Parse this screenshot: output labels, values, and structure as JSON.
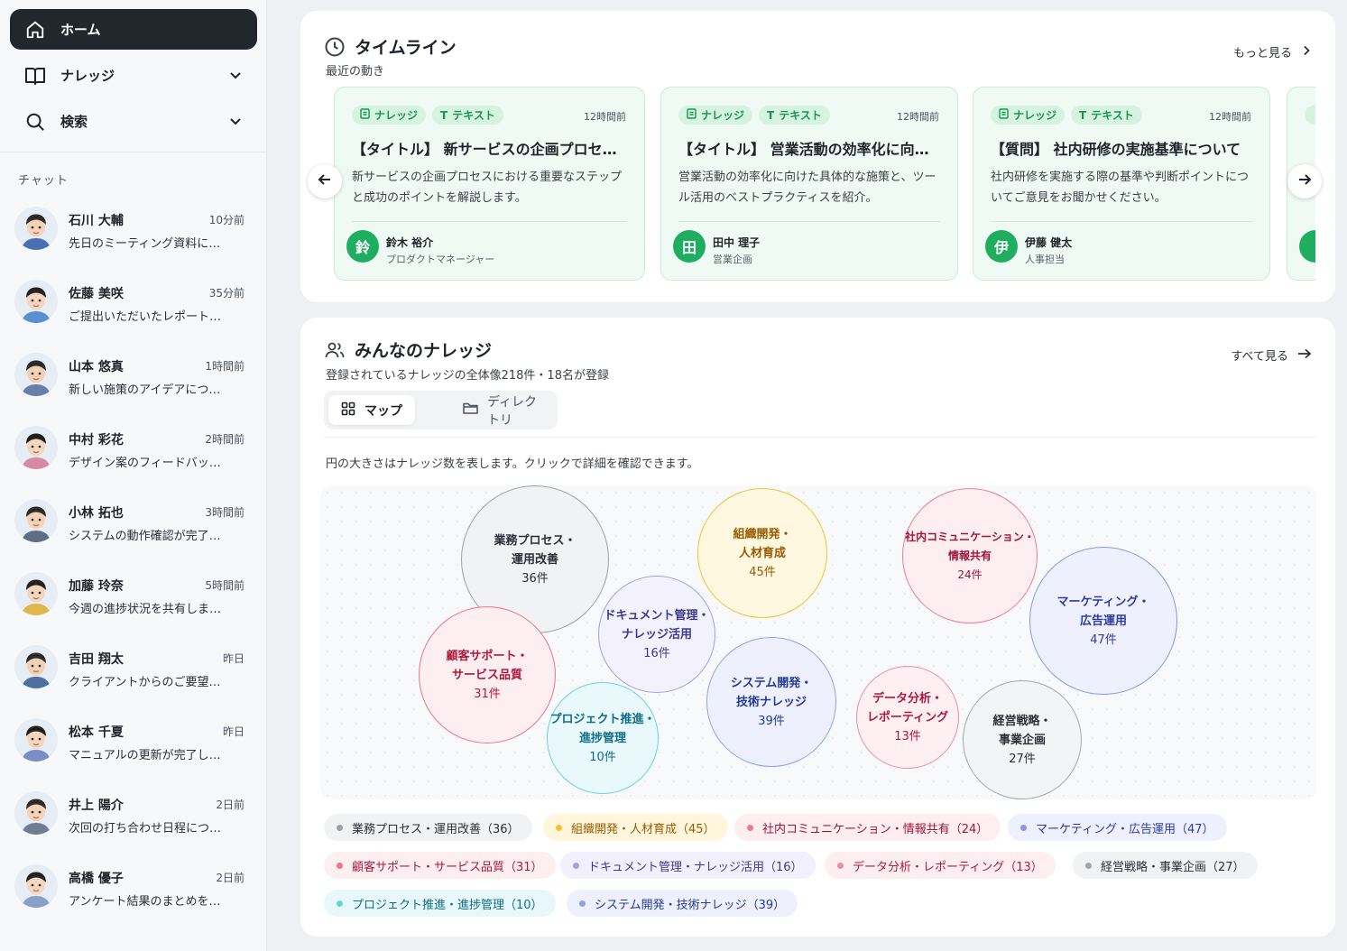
{
  "sidebar": {
    "nav": [
      {
        "label": "ホーム",
        "icon": "home-icon"
      },
      {
        "label": "ナレッジ",
        "icon": "book-icon"
      },
      {
        "label": "検索",
        "icon": "search-icon"
      }
    ],
    "chat_heading": "チャット",
    "chats": [
      {
        "name": "石川 大輔",
        "time": "10分前",
        "message": "先日のミーティング資料に…"
      },
      {
        "name": "佐藤 美咲",
        "time": "35分前",
        "message": "ご提出いただいたレポート…"
      },
      {
        "name": "山本 悠真",
        "time": "1時間前",
        "message": "新しい施策のアイデアにつ…"
      },
      {
        "name": "中村 彩花",
        "time": "2時間前",
        "message": "デザイン案のフィードバッ…"
      },
      {
        "name": "小林 拓也",
        "time": "3時間前",
        "message": "システムの動作確認が完了…"
      },
      {
        "name": "加藤 玲奈",
        "time": "5時間前",
        "message": "今週の進捗状況を共有しま…"
      },
      {
        "name": "吉田 翔太",
        "time": "昨日",
        "message": "クライアントからのご要望…"
      },
      {
        "name": "松本 千夏",
        "time": "昨日",
        "message": "マニュアルの更新が完了し…"
      },
      {
        "name": "井上 陽介",
        "time": "2日前",
        "message": "次回の打ち合わせ日程につ…"
      },
      {
        "name": "高橋 優子",
        "time": "2日前",
        "message": "アンケート結果のまとめを…"
      }
    ]
  },
  "timeline": {
    "title": "タイムライン",
    "subtitle": "最近の動き",
    "more_link": "もっと見る",
    "cards": [
      {
        "tag1": "ナレッジ",
        "tag2": "テキスト",
        "time": "12時間前",
        "title": "【タイトル】 新サービスの企画プロセスにおける重要なステップ",
        "body": "新サービスの企画プロセスにおける重要なステップと成功のポイントを解説します。",
        "author_initial": "鈴",
        "author": "鈴木 裕介",
        "role": "プロダクトマネージャー"
      },
      {
        "tag1": "ナレッジ",
        "tag2": "テキスト",
        "time": "12時間前",
        "title": "【タイトル】 営業活動の効率化に向けた具体的な施策",
        "body": "営業活動の効率化に向けた具体的な施策と、ツール活用のベストプラクティスを紹介。",
        "author_initial": "田",
        "author": "田中 理子",
        "role": "営業企画"
      },
      {
        "tag1": "ナレッジ",
        "tag2": "テキスト",
        "time": "12時間前",
        "title": "【質問】 社内研修の実施基準について",
        "body": "社内研修を実施する際の基準や判断ポイントについてご意見をお聞かせください。",
        "author_initial": "伊",
        "author": "伊藤 健太",
        "role": "人事担当"
      }
    ]
  },
  "knowledge": {
    "title": "みんなのナレッジ",
    "subtitle": "登録されているナレッジの全体像218件・18名が登録",
    "all_link": "すべて見る",
    "tab_map": "マップ",
    "tab_directory": "ディレクトリ",
    "note": "円の大きさはナレッジ数を表します。クリックで詳細を確認できます。",
    "categories": [
      {
        "line1": "業務プロセス・",
        "line2": "運用改善",
        "count": "36件",
        "legend": "業務プロセス・運用改善（36）",
        "color": "#9aa0aa",
        "text": "#2b2f36"
      },
      {
        "line1": "組織開発・",
        "line2": "人材育成",
        "count": "45件",
        "legend": "組織開発・人材育成（45）",
        "color": "#f2c230",
        "text": "#9a5a00"
      },
      {
        "line1": "社内コミュニケーション・",
        "line2": "情報共有",
        "count": "24件",
        "legend": "社内コミュニケーション・情報共有（24）",
        "color": "#f07a94",
        "text": "#a3143a"
      },
      {
        "line1": "マーケティング・",
        "line2": "広告運用",
        "count": "47件",
        "legend": "マーケティング・広告運用（47）",
        "color": "#8a95ea",
        "text": "#2f3c9e"
      },
      {
        "line1": "顧客サポート・",
        "line2": "サービス品質",
        "count": "31件",
        "legend": "顧客サポート・サービス品質（31）",
        "color": "#f0728b",
        "text": "#b0183d"
      },
      {
        "line1": "ドキュメント管理・",
        "line2": "ナレッジ活用",
        "count": "16件",
        "legend": "ドキュメント管理・ナレッジ活用（16）",
        "color": "#a4a0e6",
        "text": "#3b3a8f"
      },
      {
        "line1": "データ分析・",
        "line2": "レポーティング",
        "count": "13件",
        "legend": "データ分析・レポーティング（13）",
        "color": "#f08ca2",
        "text": "#b0183d"
      },
      {
        "line1": "経営戦略・",
        "line2": "事業企画",
        "count": "27件",
        "legend": "経営戦略・事業企画（27）",
        "color": "#a2a7ad",
        "text": "#2b2f36"
      },
      {
        "line1": "プロジェクト推進・",
        "line2": "進捗管理",
        "count": "10件",
        "legend": "プロジェクト推進・進捗管理（10）",
        "color": "#6bd0e2",
        "text": "#0f6d86"
      },
      {
        "line1": "システム開発・",
        "line2": "技術ナレッジ",
        "count": "39件",
        "legend": "システム開発・技術ナレッジ（39）",
        "color": "#8ea2ea",
        "text": "#243a96"
      }
    ]
  }
}
